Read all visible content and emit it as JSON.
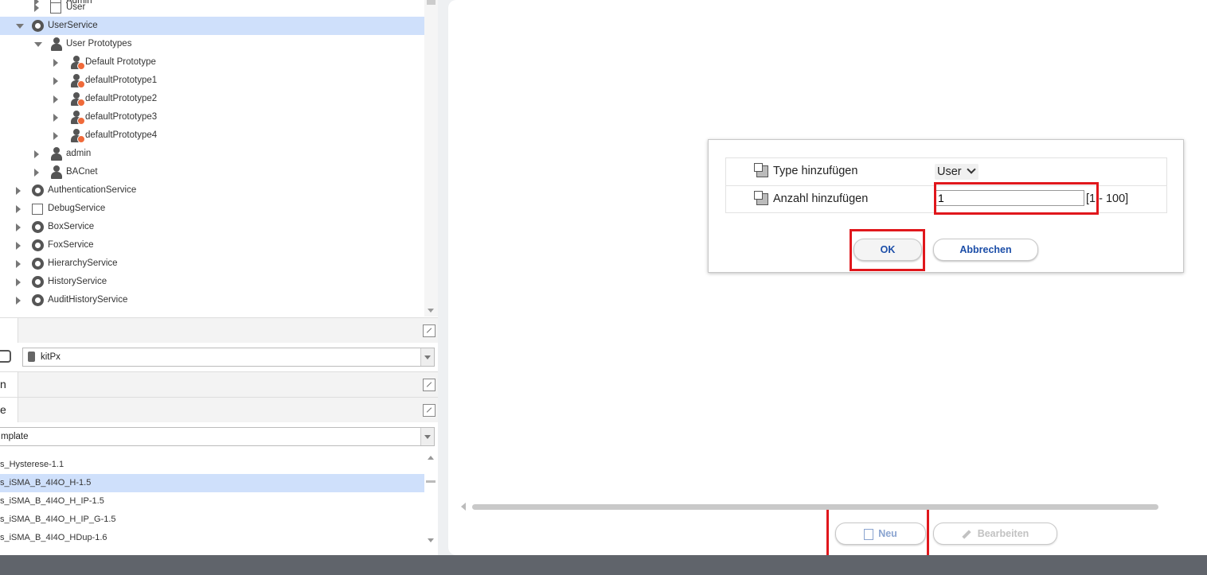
{
  "tree": {
    "items": [
      {
        "label": "Admin",
        "indent": 2,
        "state": "collapsed",
        "icon": "user-folder-icon"
      },
      {
        "label": "User",
        "indent": 2,
        "state": "collapsed",
        "icon": "user-folder-icon"
      },
      {
        "label": "UserService",
        "indent": 1,
        "state": "expanded",
        "icon": "user-service-icon",
        "selected": true
      },
      {
        "label": "User Prototypes",
        "indent": 2,
        "state": "expanded",
        "icon": "person-icon"
      },
      {
        "label": "Default Prototype",
        "indent": 3,
        "state": "collapsed",
        "icon": "prototype-icon"
      },
      {
        "label": "defaultPrototype1",
        "indent": 3,
        "state": "collapsed",
        "icon": "prototype-icon"
      },
      {
        "label": "defaultPrototype2",
        "indent": 3,
        "state": "collapsed",
        "icon": "prototype-icon"
      },
      {
        "label": "defaultPrototype3",
        "indent": 3,
        "state": "collapsed",
        "icon": "prototype-icon"
      },
      {
        "label": "defaultPrototype4",
        "indent": 3,
        "state": "collapsed",
        "icon": "prototype-icon"
      },
      {
        "label": "admin",
        "indent": 2,
        "state": "collapsed",
        "icon": "person-icon"
      },
      {
        "label": "BACnet",
        "indent": 2,
        "state": "collapsed",
        "icon": "person-icon"
      },
      {
        "label": "AuthenticationService",
        "indent": 1,
        "state": "collapsed",
        "icon": "lock-icon"
      },
      {
        "label": "DebugService",
        "indent": 1,
        "state": "collapsed",
        "icon": "debug-icon"
      },
      {
        "label": "BoxService",
        "indent": 1,
        "state": "collapsed",
        "icon": "box-icon"
      },
      {
        "label": "FoxService",
        "indent": 1,
        "state": "collapsed",
        "icon": "fox-icon"
      },
      {
        "label": "HierarchyService",
        "indent": 1,
        "state": "collapsed",
        "icon": "hierarchy-icon"
      },
      {
        "label": "HistoryService",
        "indent": 1,
        "state": "collapsed",
        "icon": "history-icon"
      },
      {
        "label": "AuditHistoryService",
        "indent": 1,
        "state": "collapsed",
        "icon": "audit-icon"
      }
    ]
  },
  "palette": {
    "selector_value": "kitPx",
    "section_label_1": "n",
    "section_label_2": "e",
    "template_value": "mplate"
  },
  "templates": {
    "items": [
      {
        "label": "s_Hysterese-1.1",
        "selected": false
      },
      {
        "label": "s_iSMA_B_4I4O_H-1.5",
        "selected": true
      },
      {
        "label": "s_iSMA_B_4I4O_H_IP-1.5",
        "selected": false
      },
      {
        "label": "s_iSMA_B_4I4O_H_IP_G-1.5",
        "selected": false
      },
      {
        "label": "s_iSMA_B_4I4O_HDup-1.6",
        "selected": false
      }
    ]
  },
  "dialog": {
    "type_label": "Type hinzufügen",
    "type_value": "User",
    "count_label": "Anzahl hinzufügen",
    "count_value": "1",
    "count_range": "[1 - 100]",
    "ok_label": "OK",
    "cancel_label": "Abbrechen"
  },
  "actions": {
    "new_label": "Neu",
    "edit_label": "Bearbeiten"
  },
  "colors": {
    "selection": "#cfe0fb",
    "highlight_box": "#e0171c",
    "button_text": "#1c4ea8"
  }
}
